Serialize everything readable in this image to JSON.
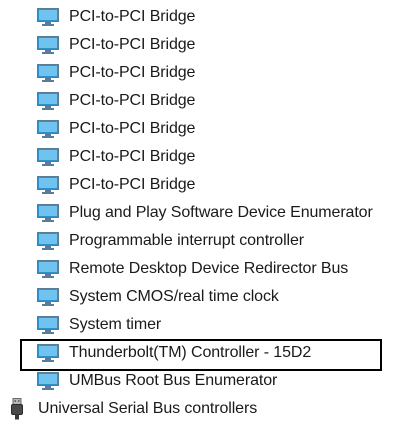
{
  "tree": {
    "device_items": [
      {
        "label": "PCI-to-PCI Bridge",
        "icon": "device-monitor-icon"
      },
      {
        "label": "PCI-to-PCI Bridge",
        "icon": "device-monitor-icon"
      },
      {
        "label": "PCI-to-PCI Bridge",
        "icon": "device-monitor-icon"
      },
      {
        "label": "PCI-to-PCI Bridge",
        "icon": "device-monitor-icon"
      },
      {
        "label": "PCI-to-PCI Bridge",
        "icon": "device-monitor-icon"
      },
      {
        "label": "PCI-to-PCI Bridge",
        "icon": "device-monitor-icon"
      },
      {
        "label": "PCI-to-PCI Bridge",
        "icon": "device-monitor-icon"
      },
      {
        "label": "Plug and Play Software Device Enumerator",
        "icon": "device-monitor-icon"
      },
      {
        "label": "Programmable interrupt controller",
        "icon": "device-monitor-icon"
      },
      {
        "label": "Remote Desktop Device Redirector Bus",
        "icon": "device-monitor-icon"
      },
      {
        "label": "System CMOS/real time clock",
        "icon": "device-monitor-icon"
      },
      {
        "label": "System timer",
        "icon": "device-monitor-icon"
      },
      {
        "label": "Thunderbolt(TM) Controller - 15D2",
        "icon": "device-monitor-icon",
        "highlighted": true
      },
      {
        "label": "UMBus Root Bus Enumerator",
        "icon": "device-monitor-icon"
      }
    ],
    "category": {
      "label": "Universal Serial Bus controllers",
      "icon": "usb-plug-icon"
    }
  },
  "colors": {
    "screen_light": "#6fc3ee",
    "screen_dark": "#2b8fd0",
    "bezel": "#5a7c95",
    "highlight_border": "#000000"
  }
}
